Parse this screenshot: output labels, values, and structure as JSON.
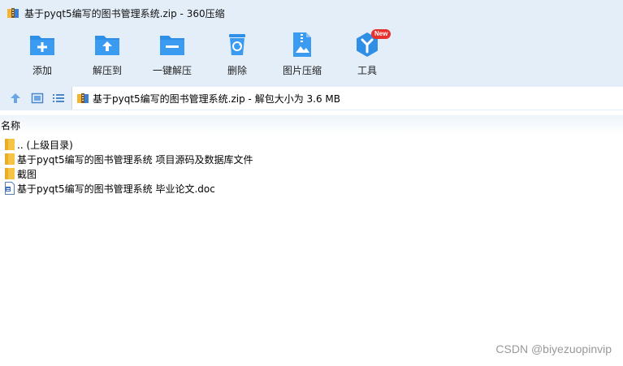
{
  "window": {
    "title": "基于pyqt5编写的图书管理系统.zip - 360压缩"
  },
  "toolbar": {
    "items": [
      {
        "label": "添加",
        "icon": "add-folder-icon"
      },
      {
        "label": "解压到",
        "icon": "extract-to-icon"
      },
      {
        "label": "一键解压",
        "icon": "one-click-extract-icon"
      },
      {
        "label": "删除",
        "icon": "recycle-bin-icon"
      },
      {
        "label": "图片压缩",
        "icon": "image-compress-icon"
      },
      {
        "label": "工具",
        "icon": "tools-icon",
        "badge": "New"
      }
    ]
  },
  "addressbar": {
    "path": "基于pyqt5编写的图书管理系统.zip - 解包大小为 3.6 MB"
  },
  "columns": {
    "name": "名称"
  },
  "files": [
    {
      "name": ".. (上级目录)",
      "type": "folder"
    },
    {
      "name": "基于pyqt5编写的图书管理系统 项目源码及数据库文件",
      "type": "folder"
    },
    {
      "name": "截图",
      "type": "folder"
    },
    {
      "name": "基于pyqt5编写的图书管理系统 毕业论文.doc",
      "type": "doc"
    }
  ],
  "watermark": "CSDN @biyezuopinvip",
  "colors": {
    "chrome": "#e4eef9",
    "icon_blue": "#2f8ee6",
    "folder_yellow": "#f5c445",
    "badge_red": "#e8302c"
  }
}
